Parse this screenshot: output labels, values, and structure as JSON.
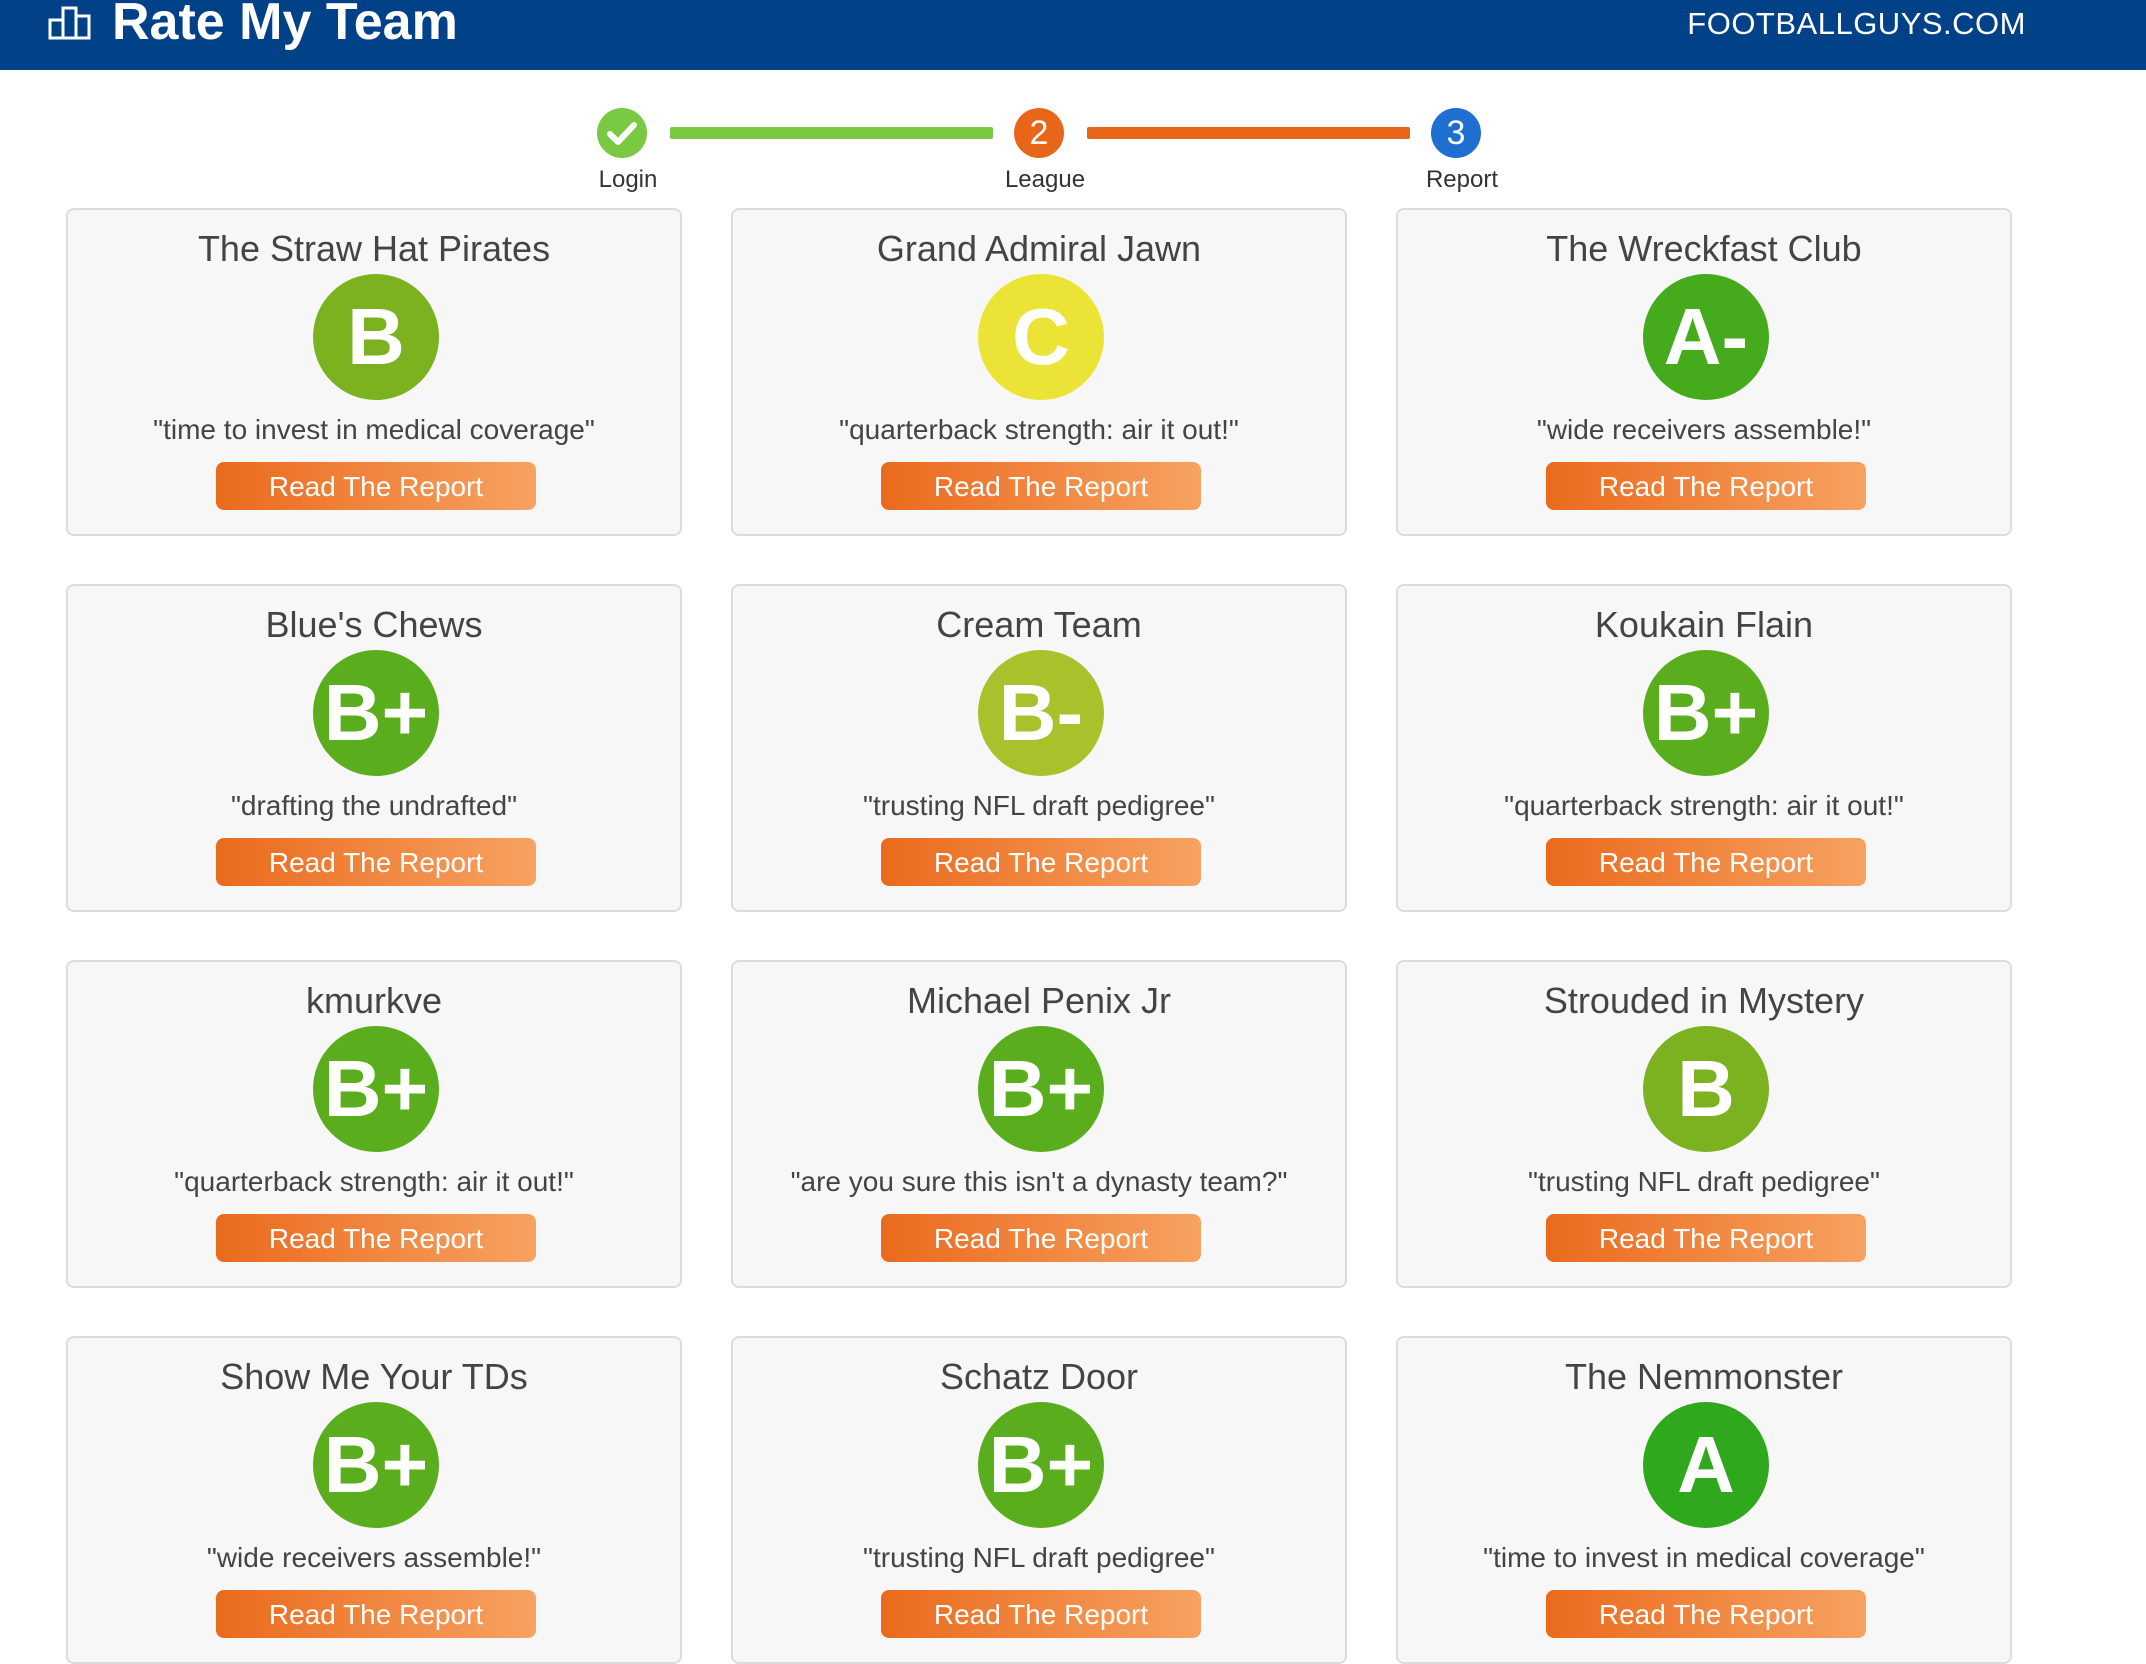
{
  "header": {
    "title": "Rate My Team",
    "site": "FOOTBALLGUYS.COM",
    "logo_icon": "podium-icon"
  },
  "colors": {
    "header_bg": "#004188",
    "step_done": "#7ac943",
    "step_active": "#e8661a",
    "step_next": "#1f6fd1",
    "button": "#ee7a2c",
    "grade_yellow": "#ece337",
    "grade_green_mid": "#7cb11f",
    "grade_green": "#5aae1d",
    "grade_green_dark": "#2fa81d",
    "grade_lime": "#a7c22a"
  },
  "stepper": {
    "steps": [
      {
        "label": "Login",
        "number": "",
        "state": "done"
      },
      {
        "label": "League",
        "number": "2",
        "state": "active"
      },
      {
        "label": "Report",
        "number": "3",
        "state": "next"
      }
    ]
  },
  "teams": [
    {
      "name": "The Straw Hat Pirates",
      "grade": "B",
      "color": "#7cb11f",
      "quote": "\"time to invest in medical coverage\"",
      "button": "Read The Report"
    },
    {
      "name": "Grand Admiral Jawn",
      "grade": "C",
      "color": "#ece337",
      "quote": "\"quarterback strength: air it out!\"",
      "button": "Read The Report"
    },
    {
      "name": "The Wreckfast Club",
      "grade": "A-",
      "color": "#45aa1c",
      "quote": "\"wide receivers assemble!\"",
      "button": "Read The Report"
    },
    {
      "name": "Blue's Chews",
      "grade": "B+",
      "color": "#5aae1d",
      "quote": "\"drafting the undrafted\"",
      "button": "Read The Report"
    },
    {
      "name": "Cream Team",
      "grade": "B-",
      "color": "#a7c22a",
      "quote": "\"trusting NFL draft pedigree\"",
      "button": "Read The Report"
    },
    {
      "name": "Koukain Flain",
      "grade": "B+",
      "color": "#5aae1d",
      "quote": "\"quarterback strength: air it out!\"",
      "button": "Read The Report"
    },
    {
      "name": "kmurkve",
      "grade": "B+",
      "color": "#5aae1d",
      "quote": "\"quarterback strength: air it out!\"",
      "button": "Read The Report"
    },
    {
      "name": "Michael Penix Jr",
      "grade": "B+",
      "color": "#5aae1d",
      "quote": "\"are you sure this isn't a dynasty team?\"",
      "button": "Read The Report"
    },
    {
      "name": "Strouded in Mystery",
      "grade": "B",
      "color": "#7cb11f",
      "quote": "\"trusting NFL draft pedigree\"",
      "button": "Read The Report"
    },
    {
      "name": "Show Me Your TDs",
      "grade": "B+",
      "color": "#5aae1d",
      "quote": "\"wide receivers assemble!\"",
      "button": "Read The Report"
    },
    {
      "name": "Schatz Door",
      "grade": "B+",
      "color": "#5aae1d",
      "quote": "\"trusting NFL draft pedigree\"",
      "button": "Read The Report"
    },
    {
      "name": "The Nemmonster",
      "grade": "A",
      "color": "#2fa81d",
      "quote": "\"time to invest in medical coverage\"",
      "button": "Read The Report"
    }
  ]
}
